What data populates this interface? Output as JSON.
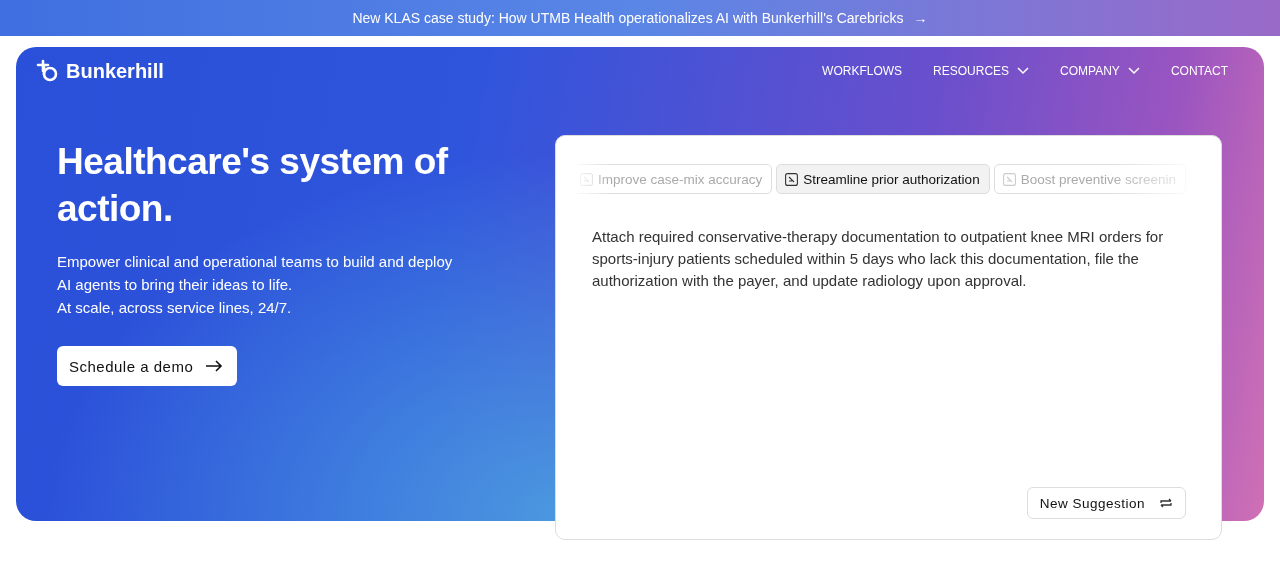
{
  "announcement": {
    "text": "New KLAS case study: How UTMB Health operationalizes AI with Bunkerhill's Carebricks",
    "arrow": "→"
  },
  "brand": {
    "name": "Bunkerhill"
  },
  "nav": [
    {
      "label": "WORKFLOWS",
      "kind": "link"
    },
    {
      "label": "RESOURCES",
      "kind": "dropdown"
    },
    {
      "label": "COMPANY",
      "kind": "dropdown"
    },
    {
      "label": "CONTACT",
      "kind": "link"
    }
  ],
  "hero": {
    "title": "Healthcare's system of action.",
    "lines": [
      "Empower clinical and operational teams to build and deploy",
      "AI agents to bring their ideas to life.",
      "At scale, across service lines, 24/7."
    ],
    "cta": "Schedule a demo"
  },
  "demo": {
    "tabs": [
      {
        "label": "Improve case-mix accuracy",
        "selected": false
      },
      {
        "label": "Streamline prior authorization",
        "selected": true
      },
      {
        "label": "Boost preventive screenin",
        "selected": false
      }
    ],
    "prompt": "Attach required conservative-therapy documentation to outpatient knee MRI orders for sports-injury patients scheduled within 5 days who lack this documentation, file the authorization with the payer, and update radiology upon approval.",
    "button": "New Suggestion"
  }
}
